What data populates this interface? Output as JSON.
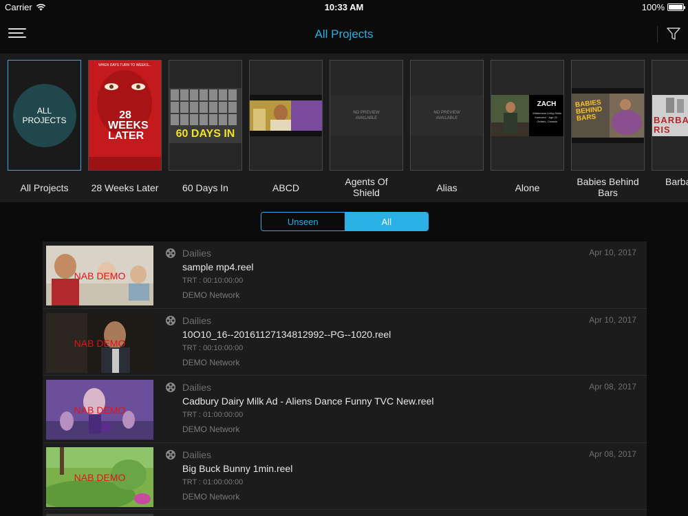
{
  "status_bar": {
    "carrier": "Carrier",
    "time": "10:33 AM",
    "battery": "100%"
  },
  "nav": {
    "title": "All Projects"
  },
  "projects": [
    {
      "label": "All Projects",
      "circle_text": "ALL PROJECTS",
      "selected": true
    },
    {
      "label": "28 Weeks Later",
      "poster_text": "28 WEEKS LATER",
      "tagline": "WHEN DAYS TURN TO WEEKS..."
    },
    {
      "label": "60 Days In",
      "poster_text": "60 DAYS IN"
    },
    {
      "label": "ABCD"
    },
    {
      "label": "Agents Of Shield",
      "preview_text": "NO PREVIEW AVAILABLE"
    },
    {
      "label": "Alias",
      "preview_text": "NO PREVIEW AVAILABLE"
    },
    {
      "label": "Alone",
      "poster_text": "ZACH",
      "poster_subtext": "Wilderness Living Skills Instructor · Age 22 · Ontario, Canada"
    },
    {
      "label": "Babies Behind Bars",
      "poster_text": "BABIES BEHIND BARS"
    },
    {
      "label": "Barba Ris",
      "poster_text": "BARBA RIS"
    }
  ],
  "segment": {
    "unseen_label": "Unseen",
    "all_label": "All",
    "selected": "All"
  },
  "reels": [
    {
      "category": "Dailies",
      "name": "sample mp4.reel",
      "trt": "TRT :  00:10:00:00",
      "network": "DEMO Network",
      "date": "Apr 10, 2017",
      "watermark": "NAB DEMO"
    },
    {
      "category": "Dailies",
      "name": "10O10_16--20161127134812992--PG--1020.reel",
      "trt": "TRT :  00:10:00:00",
      "network": "DEMO Network",
      "date": "Apr 10, 2017",
      "watermark": "NAB DEMO"
    },
    {
      "category": "Dailies",
      "name": "Cadbury Dairy Milk Ad - Aliens Dance Funny TVC New.reel",
      "trt": "TRT :  01:00:00:00",
      "network": "DEMO Network",
      "date": "Apr 08, 2017",
      "watermark": "NAB DEMO"
    },
    {
      "category": "Dailies",
      "name": "Big Buck Bunny 1min.reel",
      "trt": "TRT :  01:00:00:00",
      "network": "DEMO Network",
      "date": "Apr 08, 2017",
      "watermark": "NAB DEMO"
    }
  ],
  "colors": {
    "accent": "#2bb0e6",
    "background": "#0b0b0b",
    "panel": "#1c1c1c",
    "watermark": "#e0141a"
  }
}
